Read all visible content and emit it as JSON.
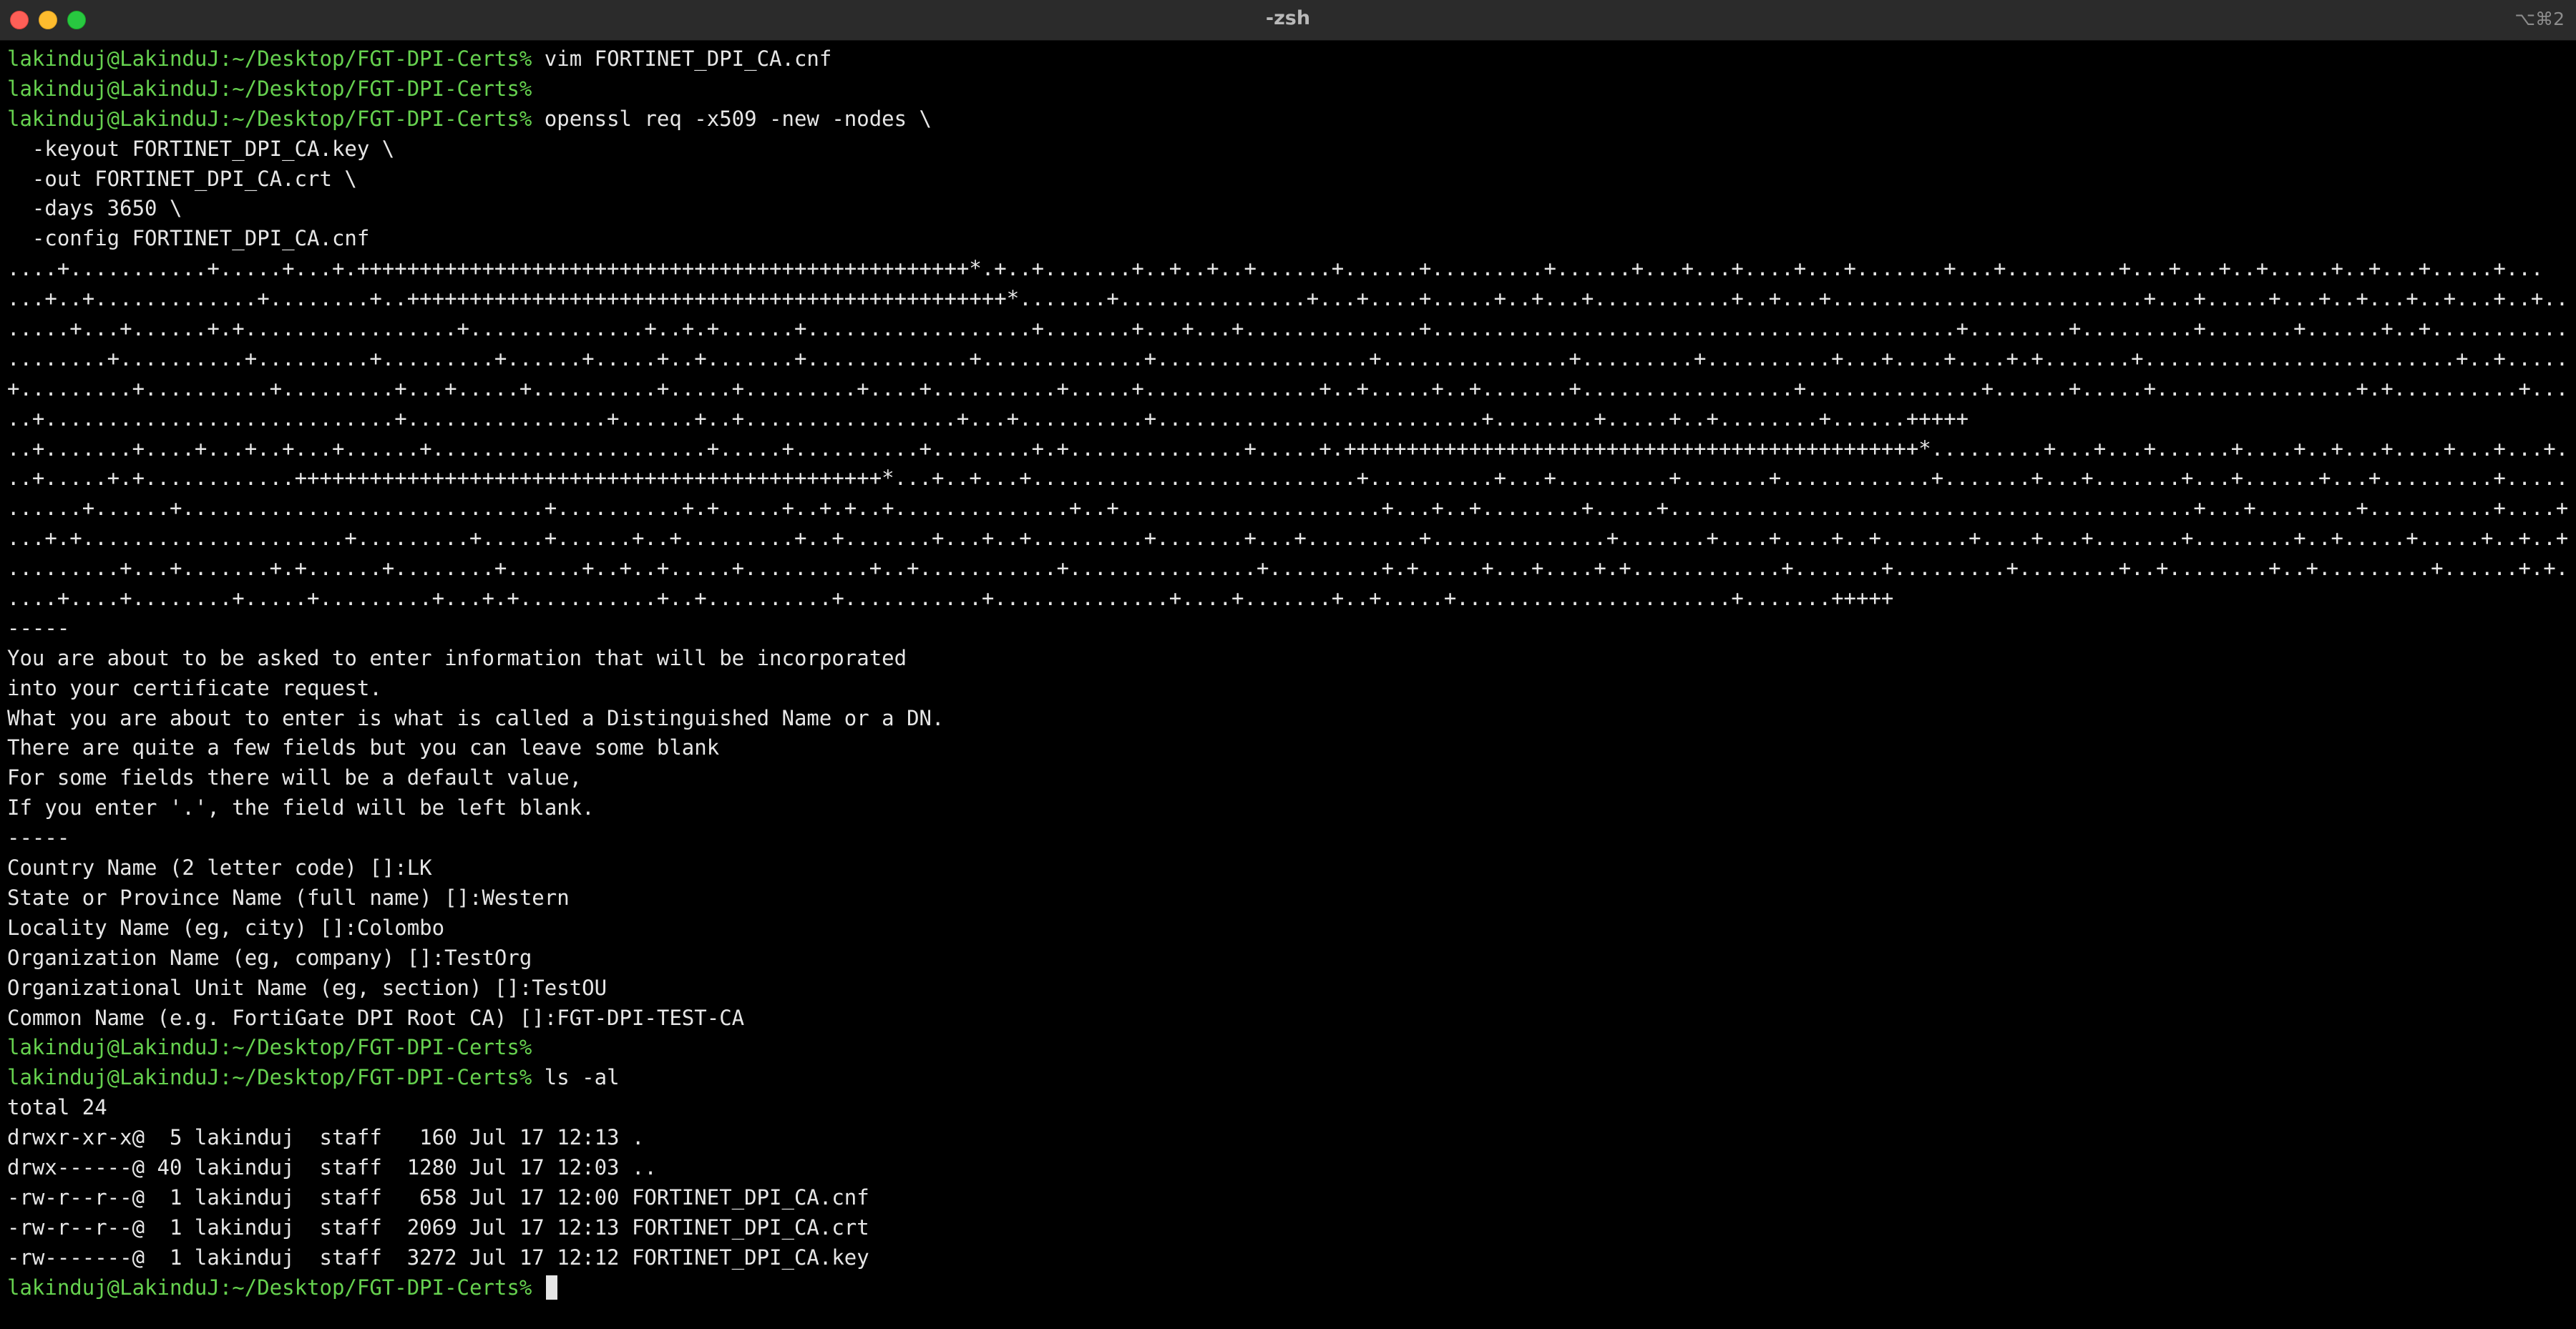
{
  "window": {
    "title": "-zsh",
    "shortcut": "⌥⌘2"
  },
  "terminal": {
    "lines": [
      {
        "prompt": "lakinduj@LakinduJ:~/Desktop/FGT-DPI-Certs%",
        "text": " vim FORTINET_DPI_CA.cnf"
      },
      {
        "prompt": "lakinduj@LakinduJ:~/Desktop/FGT-DPI-Certs%",
        "text": ""
      },
      {
        "prompt": "lakinduj@LakinduJ:~/Desktop/FGT-DPI-Certs%",
        "text": " openssl req -x509 -new -nodes \\"
      },
      {
        "prompt": "",
        "text": "  -keyout FORTINET_DPI_CA.key \\"
      },
      {
        "prompt": "",
        "text": "  -out FORTINET_DPI_CA.crt \\"
      },
      {
        "prompt": "",
        "text": "  -days 3650 \\"
      },
      {
        "prompt": "",
        "text": "  -config FORTINET_DPI_CA.cnf"
      },
      {
        "prompt": "",
        "text": "....+...........+.....+...+.+++++++++++++++++++++++++++++++++++++++++++++++++*.+..+.......+..+..+..+......+......+.........+......+...+...+....+...+.......+...+.........+...+...+..+.....+..+...+.....+..."
      },
      {
        "prompt": "",
        "text": "...+..+.............+........+..++++++++++++++++++++++++++++++++++++++++++++++++*.......+...............+...+....+.....+..+...+...........+..+...+.........................+...+.....+...+..+...+..+...+..+....+.....+......"
      },
      {
        "prompt": "",
        "text": ".....+...+......+.+.................+..............+..+.+......+..................+.......+...+...+..............+..........................................+........+.........+.......+......+..+................+"
      },
      {
        "prompt": "",
        "text": "........+..........+.........+.........+......+.....+..+.......+.............+.............+.................+...............+.........+..........+...+....+....+.+.......+.........................+..+.......+........+..."
      },
      {
        "prompt": "",
        "text": "+.........+..........+.........+...+.....+..........+.....+.........+....+..........+.....+..............+..+.....+..+.......+.................+..............+......+.....+................+.+..........+...+..+......"
      },
      {
        "prompt": "",
        "text": "..+............................+................+......+..+.................+...+..........+..........................+........+.....+..+........+......+++++"
      },
      {
        "prompt": "",
        "text": "..+.......+....+...+..+...+......+......................+.....+..........+........+.+..............+.....+.++++++++++++++++++++++++++++++++++++++++++++++*.........+...+...+......+....+..+...+....+...+...+......."
      },
      {
        "prompt": "",
        "text": "..+.....+.+............+++++++++++++++++++++++++++++++++++++++++++++++*...+..+...+..........................+..........+...+.........+.......+............+.......+...+.......+...+......+...+.........+.......+......"
      },
      {
        "prompt": "",
        "text": "......+......+.............................+..........+.+.....+..+.+..+..............+..+.....................+...+..+........+.....+..........................................+...+........+..........+....+..........+"
      },
      {
        "prompt": "",
        "text": "...+.+.....................+.........+.....+......+..+.........+..+.......+...+..+.........+.......+...+.........+..............+.......+....+....+..+.......+....+...+.......+........+..+.....+.....+..+..+....+....."
      },
      {
        "prompt": "",
        "text": ".........+...+.......+.+......+........+......+..+..+.....+..........+..+...........+...............+.........+.+.....+...+....+.+............+.......+.........+........+..+........+..+.........+......+.+....+...."
      },
      {
        "prompt": "",
        "text": "....+....+........+.....+.........+...+.+...........+..+..........+...........+..............+....+.......+..+.....+......................+.......+++++"
      },
      {
        "prompt": "",
        "text": "-----"
      },
      {
        "prompt": "",
        "text": "You are about to be asked to enter information that will be incorporated"
      },
      {
        "prompt": "",
        "text": "into your certificate request."
      },
      {
        "prompt": "",
        "text": "What you are about to enter is what is called a Distinguished Name or a DN."
      },
      {
        "prompt": "",
        "text": "There are quite a few fields but you can leave some blank"
      },
      {
        "prompt": "",
        "text": "For some fields there will be a default value,"
      },
      {
        "prompt": "",
        "text": "If you enter '.', the field will be left blank."
      },
      {
        "prompt": "",
        "text": "-----"
      },
      {
        "prompt": "",
        "text": "Country Name (2 letter code) []:LK"
      },
      {
        "prompt": "",
        "text": "State or Province Name (full name) []:Western"
      },
      {
        "prompt": "",
        "text": "Locality Name (eg, city) []:Colombo"
      },
      {
        "prompt": "",
        "text": "Organization Name (eg, company) []:TestOrg"
      },
      {
        "prompt": "",
        "text": "Organizational Unit Name (eg, section) []:TestOU"
      },
      {
        "prompt": "",
        "text": "Common Name (e.g. FortiGate DPI Root CA) []:FGT-DPI-TEST-CA"
      },
      {
        "prompt": "lakinduj@LakinduJ:~/Desktop/FGT-DPI-Certs%",
        "text": ""
      },
      {
        "prompt": "lakinduj@LakinduJ:~/Desktop/FGT-DPI-Certs%",
        "text": " ls -al"
      },
      {
        "prompt": "",
        "text": "total 24"
      },
      {
        "prompt": "",
        "text": "drwxr-xr-x@  5 lakinduj  staff   160 Jul 17 12:13 ."
      },
      {
        "prompt": "",
        "text": "drwx------@ 40 lakinduj  staff  1280 Jul 17 12:03 .."
      },
      {
        "prompt": "",
        "text": "-rw-r--r--@  1 lakinduj  staff   658 Jul 17 12:00 FORTINET_DPI_CA.cnf"
      },
      {
        "prompt": "",
        "text": "-rw-r--r--@  1 lakinduj  staff  2069 Jul 17 12:13 FORTINET_DPI_CA.crt"
      },
      {
        "prompt": "",
        "text": "-rw-------@  1 lakinduj  staff  3272 Jul 17 12:12 FORTINET_DPI_CA.key"
      },
      {
        "prompt": "lakinduj@LakinduJ:~/Desktop/FGT-DPI-Certs%",
        "text": " "
      }
    ]
  },
  "colors": {
    "background": "#000000",
    "titlebar": "#2b2b2b",
    "text": "#e6e6e6",
    "prompt": "#66d14f",
    "close": "#fe5f57",
    "minimize": "#febc2e",
    "zoom": "#28c840"
  }
}
